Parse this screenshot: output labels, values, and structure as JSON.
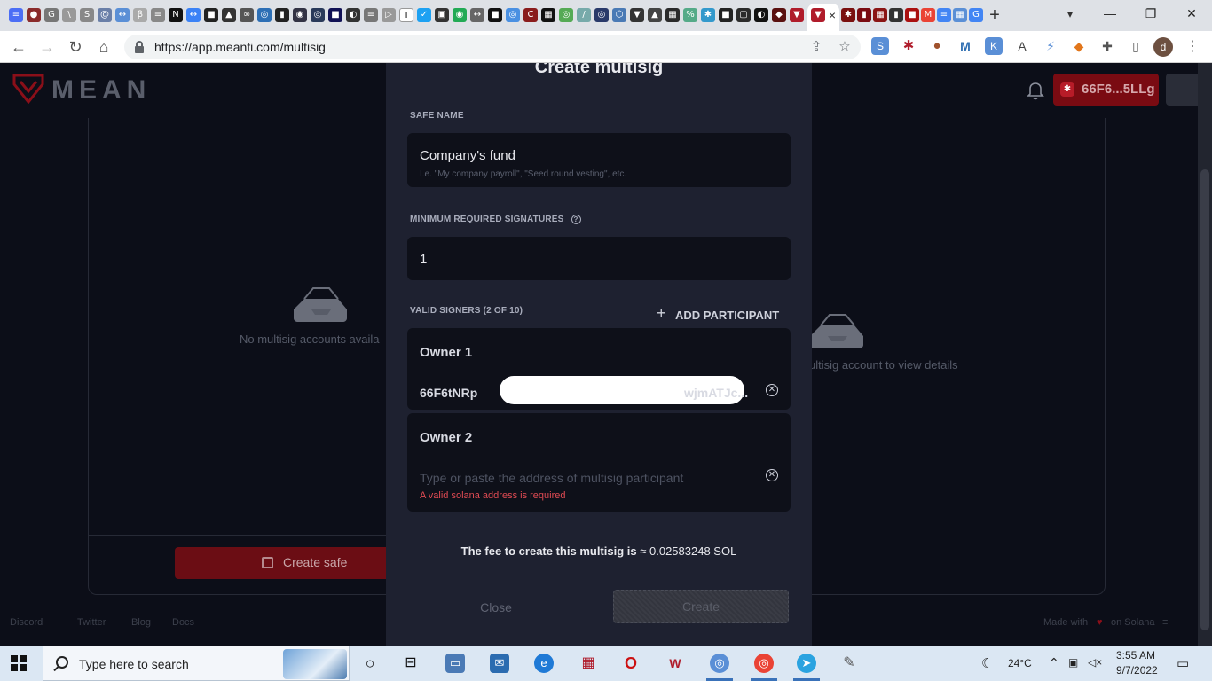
{
  "browser": {
    "url": "https://app.meanfi.com/multisig",
    "new_tab_symbol": "+",
    "close_tab_symbol": "×",
    "profile_initial": "d",
    "extensions": [
      "S",
      "K"
    ]
  },
  "app": {
    "logo_text": "MEAN",
    "wallet_label": "66F6...5LLg",
    "empty_left": "No multisig accounts availa",
    "empty_right": "ultisig account to view details",
    "create_safe_label": "Create safe",
    "footer_links": [
      "Discord",
      "Twitter",
      "Blog",
      "Docs"
    ],
    "footer_right": "Made with",
    "footer_right_suffix": "on Solana"
  },
  "modal": {
    "title": "Create multisig",
    "safe_name_label": "SAFE NAME",
    "safe_name_value": "Company's fund",
    "safe_name_hint": "I.e. \"My company payroll\", \"Seed round vesting\", etc.",
    "min_signatures_label": "MINIMUM REQUIRED SIGNATURES",
    "min_signatures_value": "1",
    "valid_signers_label": "VALID SIGNERS (2 OF 10)",
    "add_participant_label": "ADD PARTICIPANT",
    "owners": [
      {
        "title": "Owner 1",
        "address_start": "66F6tNRp",
        "address_end": "wjmATJc..."
      },
      {
        "title": "Owner 2",
        "placeholder": "Type or paste the address of multisig participant",
        "error": "A valid solana address is required"
      }
    ],
    "fee_prefix": "The fee to create this multisig is",
    "fee_value": "≈ 0.02583248 SOL",
    "close_label": "Close",
    "create_label": "Create"
  },
  "taskbar": {
    "search_placeholder": "Type here to search",
    "temperature": "24°C",
    "time": "3:55 AM",
    "date": "9/7/2022"
  },
  "colors": {
    "brand": "#7a0b12",
    "modal_bg": "#1e2130",
    "input_bg": "#0e1019",
    "error": "#e14b53"
  }
}
